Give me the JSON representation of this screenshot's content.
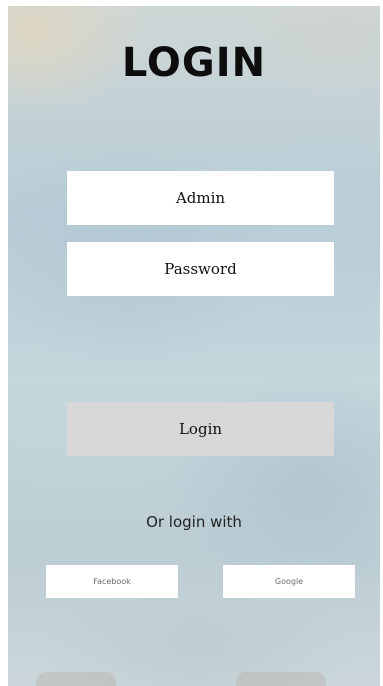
{
  "header": {
    "title": "LOGIN"
  },
  "form": {
    "username_placeholder": "Admin",
    "password_placeholder": "Password",
    "login_label": "Login"
  },
  "social": {
    "prompt": "Or login with",
    "facebook_label": "Facebook",
    "google_label": "Google"
  }
}
